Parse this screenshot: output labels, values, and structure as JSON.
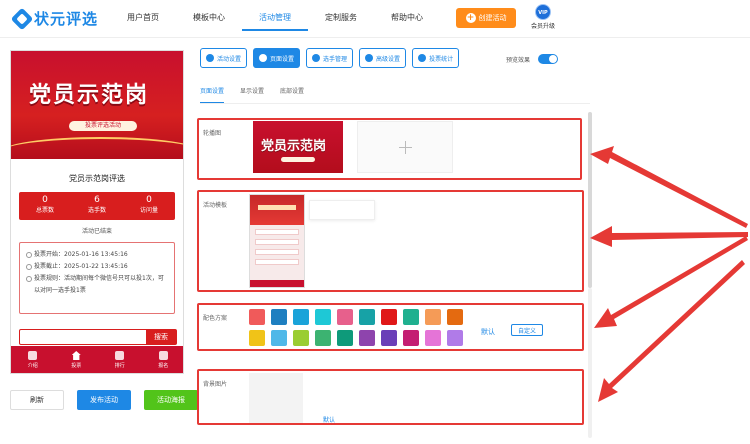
{
  "header": {
    "logo_text": "状元评选",
    "nav": [
      "用户首页",
      "模板中心",
      "活动管理",
      "定制服务",
      "帮助中心"
    ],
    "create_label": "创建活动",
    "vip_badge": "VIP",
    "vip_label": "会员升级"
  },
  "preview": {
    "banner_title": "党员示范岗",
    "banner_subtitle": "投票评选活动",
    "event_title": "党员示范岗评选",
    "stats": [
      {
        "value": "0",
        "label": "总票数"
      },
      {
        "value": "6",
        "label": "选手数"
      },
      {
        "value": "0",
        "label": "访问量"
      }
    ],
    "status": "活动已结束",
    "info": {
      "start": "投票开始：2025-01-16 13:45:16",
      "end": "投票截止：2025-01-22 13:45:16",
      "rule": "投票规则：活动期间每个微信号只可以投1次，可以对同一选手投1票"
    },
    "search_button": "搜索",
    "tabs": [
      "介绍",
      "投票",
      "排行",
      "报名"
    ]
  },
  "actions": {
    "refresh": "刷新",
    "publish": "发布活动",
    "poster": "活动海报"
  },
  "toolbar": {
    "buttons": [
      "活动设置",
      "页面设置",
      "选手管理",
      "高级设置",
      "投票统计"
    ],
    "preview_label": "预览效果"
  },
  "subtabs": [
    "页面设置",
    "显示设置",
    "底部设置"
  ],
  "sections": {
    "carousel_label": "轮播图",
    "carousel_image_title": "党员示范岗",
    "template_label": "活动模板",
    "color_label": "配色方案",
    "color_default": "默认",
    "color_custom": "自定义",
    "bg_label": "背景图片",
    "bg_default": "默认"
  },
  "colors": {
    "accent": "#1e88e5",
    "alert": "#e53935",
    "swatches": [
      "#f05a5a",
      "#1e7fc0",
      "#1aa3d9",
      "#1ec8d6",
      "#e7608c",
      "#17a2a6",
      "#e01818",
      "#1fb08f",
      "#f59b57",
      "#e46a10",
      "#f0c318",
      "#4fb8e8",
      "#9acd32",
      "#3cb371",
      "#0e9a7a",
      "#8e44ad",
      "#6a3fb8",
      "#c41e72",
      "#e574d7",
      "#b07be8"
    ]
  }
}
